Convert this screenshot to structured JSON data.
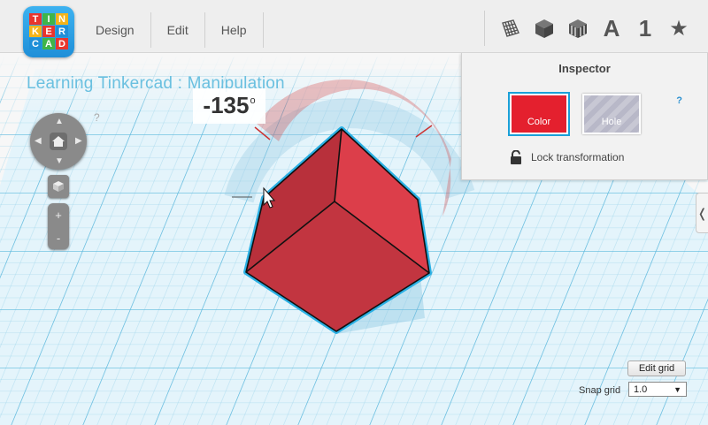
{
  "app": {
    "logo_letters": [
      "T",
      "I",
      "N",
      "K",
      "E",
      "R",
      "C",
      "A",
      "D"
    ]
  },
  "menu": [
    {
      "label": "Design"
    },
    {
      "label": "Edit"
    },
    {
      "label": "Help"
    }
  ],
  "toolbar": {
    "icons": [
      "grid-icon",
      "box-icon",
      "striped-box-icon",
      "text-icon",
      "number-icon",
      "star-icon"
    ],
    "text_label": "A",
    "number_label": "1",
    "star_label": "★"
  },
  "scene": {
    "title": "Learning Tinkercad : Manipulation",
    "help": "?",
    "rotation_angle": "-135",
    "angle_unit": "o",
    "shape_color": "#d6323f"
  },
  "nav": {
    "zoom_in": "+",
    "zoom_out": "-"
  },
  "inspector": {
    "title": "Inspector",
    "help": "?",
    "color_label": "Color",
    "hole_label": "Hole",
    "lock_label": "Lock transformation",
    "selected_color": "#e4202e"
  },
  "grid": {
    "edit_label": "Edit grid",
    "snap_label": "Snap grid",
    "snap_value": "1.0"
  },
  "side_tab": "❬"
}
